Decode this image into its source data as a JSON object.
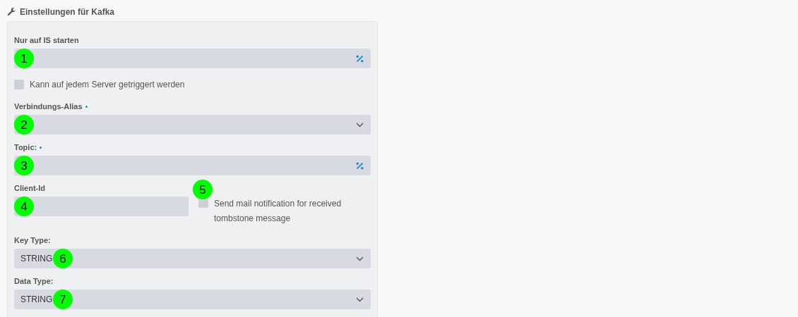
{
  "section": {
    "title": "Einstellungen für Kafka"
  },
  "rows": [
    {
      "kind": "expression-field",
      "label": "Nur auf IS starten",
      "required": false,
      "marker": "1"
    },
    {
      "kind": "checkbox",
      "label": "Kann auf jedem Server getriggert werden",
      "checked": false
    },
    {
      "kind": "select-field",
      "label": "Verbindungs-Alias",
      "required": true,
      "marker": "2"
    },
    {
      "kind": "expression-field",
      "label": "Topic:",
      "required": true,
      "marker": "3"
    },
    {
      "kind": "pair",
      "left": {
        "kind": "text-field",
        "label": "Client-Id",
        "required": false,
        "marker": "4"
      },
      "right": {
        "label": "Send mail notification for received tombstone message",
        "checked": false,
        "marker": "5"
      }
    },
    {
      "kind": "select-field",
      "label": "Key Type:",
      "required": false,
      "value": "STRING",
      "marker": "6"
    },
    {
      "kind": "select-field",
      "label": "Data Type:",
      "required": false,
      "value": "STRING",
      "marker": "7"
    }
  ]
}
